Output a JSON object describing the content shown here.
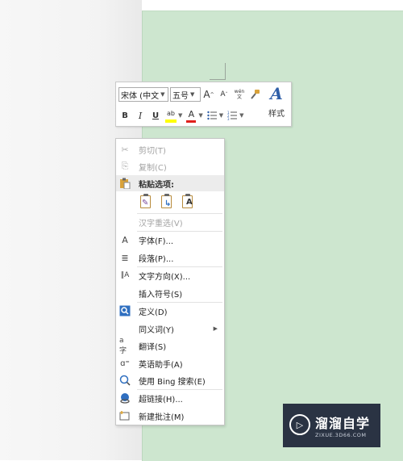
{
  "mini_toolbar": {
    "font_name": "宋体 (中文",
    "font_size": "五号",
    "grow_font_label": "A",
    "shrink_font_label": "A",
    "phonetic_label": "wén\n文",
    "bold_label": "B",
    "italic_label": "I",
    "underline_label": "U",
    "highlight_label": "ab",
    "font_color_label": "A",
    "styles_label": "样式",
    "styles_icon_label": "A",
    "colors": {
      "highlight": "#ffff00",
      "font_color": "#e0201c",
      "styles_accent": "#2f5fa8"
    }
  },
  "context_menu": {
    "items": [
      {
        "label": "剪切(T)",
        "icon": "scissors-icon",
        "enabled": false
      },
      {
        "label": "复制(C)",
        "icon": "copy-icon",
        "enabled": false
      },
      {
        "label": "粘贴选项:",
        "icon": "paste-icon",
        "enabled": true
      },
      {
        "label": "汉字重选(V)",
        "icon": "",
        "enabled": false
      },
      {
        "label": "字体(F)...",
        "icon": "font-icon",
        "enabled": true
      },
      {
        "label": "段落(P)...",
        "icon": "paragraph-icon",
        "enabled": true
      },
      {
        "label": "文字方向(X)...",
        "icon": "text-direction-icon",
        "enabled": true
      },
      {
        "label": "插入符号(S)",
        "icon": "",
        "enabled": true
      },
      {
        "label": "定义(D)",
        "icon": "define-icon",
        "enabled": true
      },
      {
        "label": "同义词(Y)",
        "icon": "",
        "enabled": true
      },
      {
        "label": "翻译(S)",
        "icon": "translate-icon",
        "enabled": true
      },
      {
        "label": "英语助手(A)",
        "icon": "english-assistant-icon",
        "enabled": true
      },
      {
        "label": "使用 Bing 搜索(E)",
        "icon": "bing-search-icon",
        "enabled": true
      },
      {
        "label": "超链接(H)...",
        "icon": "hyperlink-icon",
        "enabled": true
      },
      {
        "label": "新建批注(M)",
        "icon": "new-comment-icon",
        "enabled": true
      }
    ],
    "paste_options": [
      {
        "icon": "keep-source-formatting-icon"
      },
      {
        "icon": "merge-formatting-icon"
      },
      {
        "icon": "keep-text-only-icon",
        "mark": "A"
      }
    ]
  },
  "watermark": {
    "title": "溜溜自学",
    "subtitle": "ZIXUE.3D66.COM"
  }
}
